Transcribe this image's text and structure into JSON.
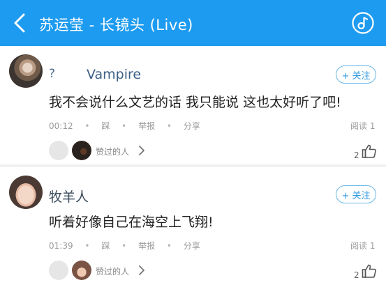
{
  "header": {
    "title": "苏运莹 - 长镜头 (Live)",
    "bg_color": "#1d9bf0"
  },
  "comments": [
    {
      "user_prefix": "?",
      "username": "Vampire",
      "follow_label": "+ 关注",
      "text": "我不会说什么文艺的话 我只能说 这也太好听了吧!",
      "time": "00:12",
      "actions": [
        "踩",
        "举报",
        "分享"
      ],
      "reads": "阅读 1",
      "likers_label": "赞过的人",
      "like_count": "2"
    },
    {
      "username": "牧羊人",
      "follow_label": "+ 关注",
      "text": "听着好像自己在海空上飞翔!",
      "time": "01:39",
      "actions": [
        "踩",
        "举报",
        "分享"
      ],
      "reads": "阅读 1",
      "likers_label": "赞过的人",
      "like_count": "2"
    }
  ],
  "icons": {
    "back": "chevron-left-icon",
    "music": "music-note-icon",
    "thumb": "thumbs-up-icon",
    "chevron": "chevron-right-icon"
  }
}
